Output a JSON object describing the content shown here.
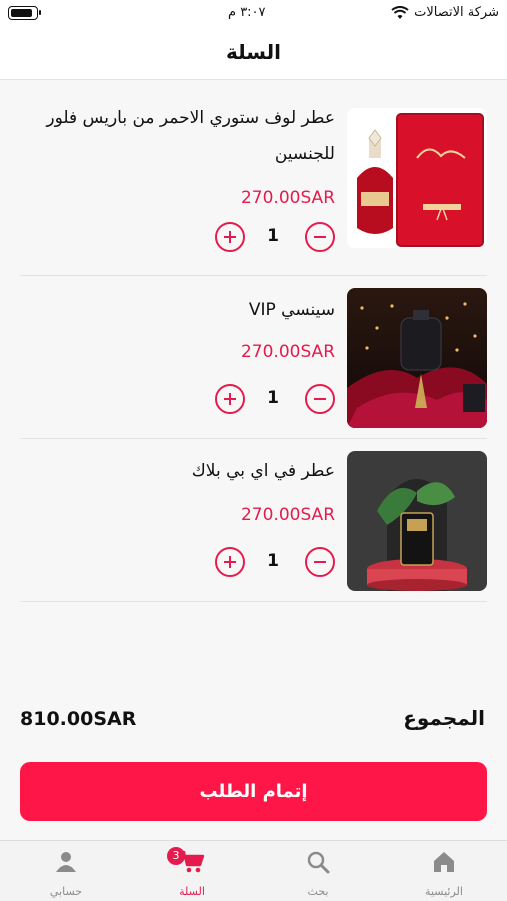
{
  "status_bar": {
    "carrier": "شركة الاتصالات",
    "time": "٣:٠٧ م"
  },
  "header": {
    "title": "السلة"
  },
  "cart": {
    "items": [
      {
        "name": "عطر لوف ستوري الاحمر من باريس فلور للجنسين",
        "price": "270.00SAR",
        "quantity": "1"
      },
      {
        "name": "سينسي VIP",
        "price": "270.00SAR",
        "quantity": "1"
      },
      {
        "name": "عطر في اي بي  بلاك",
        "price": "270.00SAR",
        "quantity": "1"
      }
    ]
  },
  "summary": {
    "total_label": "المجموع",
    "total_value": "810.00SAR"
  },
  "checkout": {
    "label": "إتمام الطلب"
  },
  "tabbar": {
    "tabs": [
      {
        "label": "الرئيسية",
        "icon": "home-icon"
      },
      {
        "label": "بحث",
        "icon": "search-icon"
      },
      {
        "label": "السلة",
        "icon": "cart-icon",
        "badge": "3",
        "active": true
      },
      {
        "label": "حسابي",
        "icon": "user-icon"
      }
    ]
  },
  "colors": {
    "accent": "#e41c4d",
    "button": "#fd1647"
  }
}
